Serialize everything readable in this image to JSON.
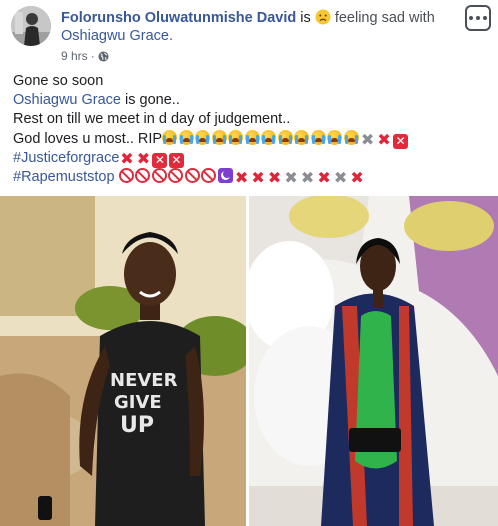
{
  "post": {
    "author_name": "Folorunsho Oluwatunmishe David",
    "connector_is": "is",
    "feeling_label": "feeling sad with",
    "tagged_person": "Oshiagwu Grace.",
    "timestamp": "9 hrs",
    "separator": "·",
    "privacy_icon": "globe-icon",
    "menu_icon": "more-options-icon",
    "feeling_icon": "sad-face-emoji"
  },
  "body": {
    "line1": "Gone so soon",
    "line2_link": "Oshiagwu Grace",
    "line2_rest": " is gone..",
    "line3": "Rest on till we meet in d day of judgement..",
    "line4": "God loves u most.. RIP",
    "hashtag1": "#Justiceforgrace",
    "hashtag2": "#Rapemuststop"
  },
  "emoji_names": {
    "crying": "loudly-crying-face-emoji",
    "grey_x": "heavy-multiplication-x-emoji",
    "red_x": "cross-mark-emoji",
    "boxed_x": "negative-squared-cross-mark-emoji",
    "no_entry": "no-entry-sign-emoji",
    "moon": "crescent-moon-emoji"
  },
  "photos": [
    {
      "name": "photo-girl-never-give-up-shirt"
    },
    {
      "name": "photo-girl-graduation-gown"
    }
  ],
  "colors": {
    "link": "#385898",
    "text": "#1c1e21",
    "meta": "#606770",
    "red": "#e0243a"
  }
}
